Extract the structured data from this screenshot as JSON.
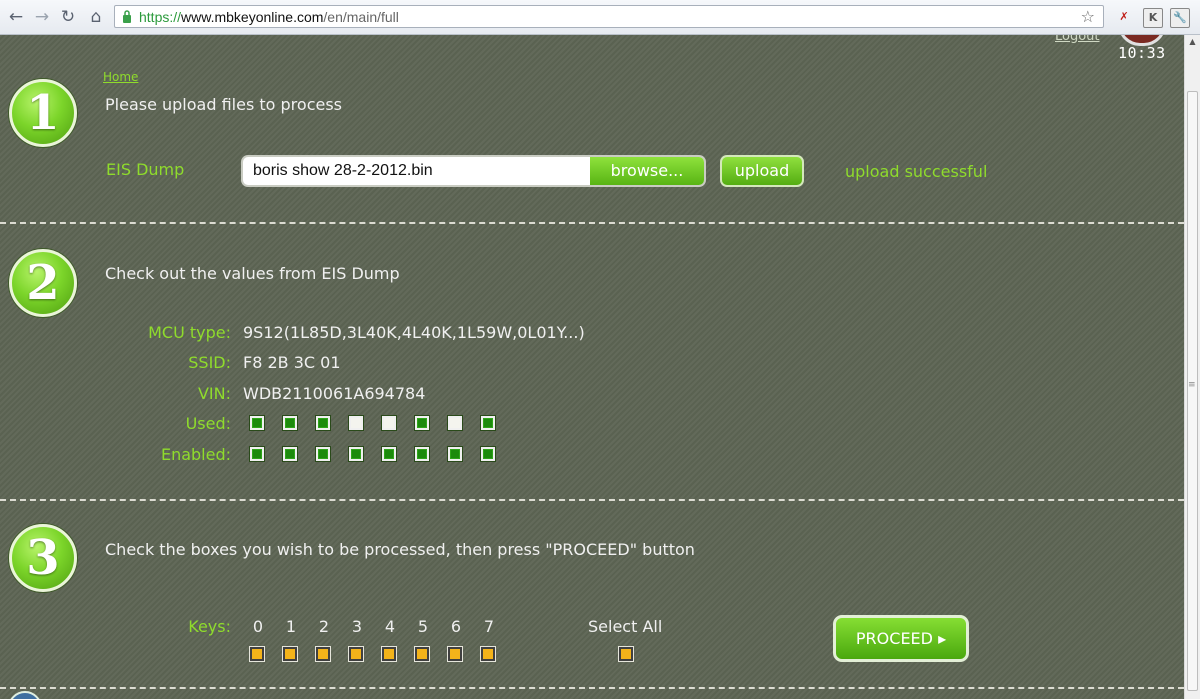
{
  "browser": {
    "url_scheme": "https://",
    "url_host": "www.mbkeyonline.com",
    "url_path": "/en/main/full"
  },
  "header": {
    "logout": "Logout",
    "clock": "10:33"
  },
  "step1": {
    "number": "1",
    "breadcrumb": "Home",
    "heading": "Please upload files to process",
    "field_label": "EIS Dump",
    "file_name": "boris show 28-2-2012.bin",
    "browse_label": "browse...",
    "upload_label": "upload",
    "status": "upload successful"
  },
  "step2": {
    "number": "2",
    "heading": "Check out the values from EIS Dump",
    "mcu_label": "MCU type:",
    "mcu_value": "9S12(1L85D,3L40K,4L40K,1L59W,0L01Y...)",
    "ssid_label": "SSID:",
    "ssid_value": "F8 2B 3C 01",
    "vin_label": "VIN:",
    "vin_value": "WDB2110061A694784",
    "used_label": "Used:",
    "used": [
      true,
      true,
      true,
      false,
      false,
      true,
      false,
      true
    ],
    "enabled_label": "Enabled:",
    "enabled": [
      true,
      true,
      true,
      true,
      true,
      true,
      true,
      true
    ]
  },
  "step3": {
    "number": "3",
    "heading": "Check the boxes you wish to be processed, then press \"PROCEED\" button",
    "keys_label": "Keys:",
    "keys": [
      "0",
      "1",
      "2",
      "3",
      "4",
      "5",
      "6",
      "7"
    ],
    "select_all_label": "Select All",
    "proceed_label": "PROCEED ▸"
  }
}
